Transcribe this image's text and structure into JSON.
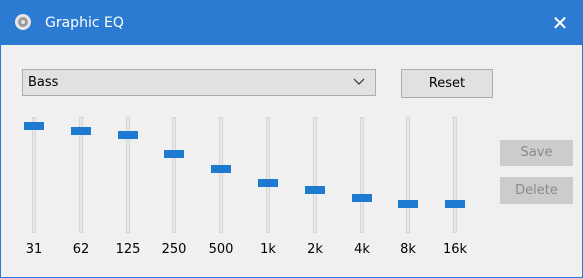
{
  "window": {
    "title": "Graphic EQ",
    "close_glyph": "✕",
    "accent_color": "#2b7bd3",
    "app_icon": "speaker-icon"
  },
  "preset": {
    "selected": "Bass",
    "icon": "chevron-down-icon"
  },
  "buttons": {
    "reset": "Reset",
    "save": "Save",
    "delete": "Delete",
    "save_enabled": false,
    "delete_enabled": false
  },
  "bands": [
    {
      "label": "31",
      "level": 0.95
    },
    {
      "label": "62",
      "level": 0.91
    },
    {
      "label": "125",
      "level": 0.87
    },
    {
      "label": "250",
      "level": 0.69
    },
    {
      "label": "500",
      "level": 0.56
    },
    {
      "label": "1k",
      "level": 0.43
    },
    {
      "label": "2k",
      "level": 0.36
    },
    {
      "label": "4k",
      "level": 0.29
    },
    {
      "label": "8k",
      "level": 0.23
    },
    {
      "label": "16k",
      "level": 0.23
    }
  ]
}
